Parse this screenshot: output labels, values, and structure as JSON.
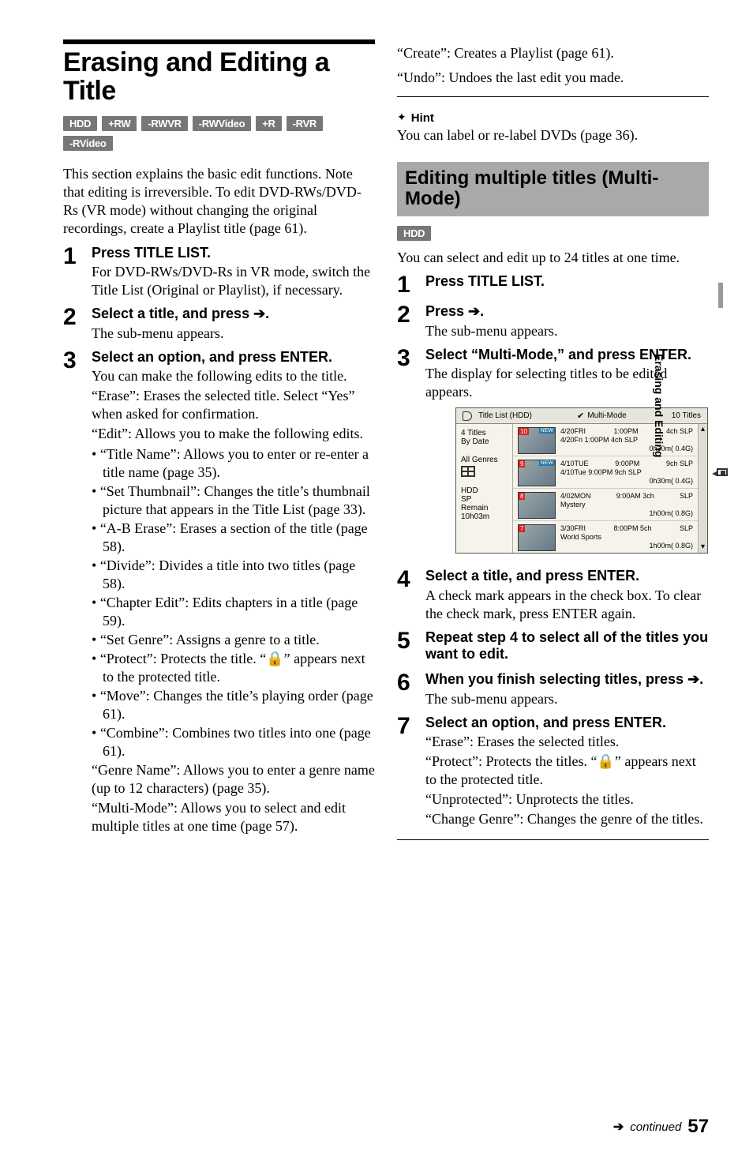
{
  "left": {
    "section_title": "Erasing and Editing a Title",
    "badges": [
      "HDD",
      "+RW",
      "-RWVR",
      "-RWVideo",
      "+R",
      "-RVR",
      "-RVideo"
    ],
    "intro": "This section explains the basic edit functions. Note that editing is irreversible. To edit DVD-RWs/DVD-Rs (VR mode) without changing the original recordings, create a Playlist title (page 61).",
    "steps": [
      {
        "num": "1",
        "head": "Press TITLE LIST.",
        "body": "For DVD-RWs/DVD-Rs in VR mode, switch the Title List (Original or Playlist), if necessary."
      },
      {
        "num": "2",
        "head": "Select a title, and press ➔.",
        "body": "The sub-menu appears."
      },
      {
        "num": "3",
        "head": "Select an option, and press ENTER.",
        "body_pre": "You can make the following edits to the title.",
        "lines_before_bullets": [
          "“Erase”: Erases the selected title. Select “Yes” when asked for confirmation.",
          "“Edit”: Allows you to make the following edits."
        ],
        "bullets": [
          "“Title Name”: Allows you to enter or re-enter a title name (page 35).",
          "“Set Thumbnail”: Changes the title’s thumbnail picture that appears in the Title List (page 33).",
          "“A-B Erase”: Erases a section of the title (page 58).",
          "“Divide”: Divides a title into two titles (page 58).",
          "“Chapter Edit”: Edits chapters in a title (page 59).",
          "“Set Genre”: Assigns a genre to a title.",
          "“Protect”: Protects the title. “🔒” appears next to the protected title.",
          "“Move”: Changes the title’s playing order (page 61).",
          "“Combine”: Combines two titles into one (page 61)."
        ],
        "lines_after_bullets": [
          "“Genre Name”: Allows you to enter a genre name (up to 12 characters) (page 35).",
          "“Multi-Mode”: Allows you to select and edit multiple titles at one time (page 57)."
        ]
      }
    ]
  },
  "right": {
    "top_lines": [
      "“Create”: Creates a Playlist (page 61).",
      "“Undo”: Undoes the last edit you made."
    ],
    "hint_label": "Hint",
    "hint_text": "You can label or re-label DVDs (page 36).",
    "subsection_title": "Editing multiple titles (Multi-Mode)",
    "sub_badge": "HDD",
    "sub_intro": "You can select and edit up to 24 titles at one time.",
    "steps": [
      {
        "num": "1",
        "head": "Press TITLE LIST."
      },
      {
        "num": "2",
        "head": "Press ➔.",
        "body": "The sub-menu appears."
      },
      {
        "num": "3",
        "head": "Select “Multi-Mode,” and press ENTER.",
        "body": "The display for selecting titles to be edited appears."
      },
      {
        "num": "4",
        "head": "Select a title, and press ENTER.",
        "body": "A check mark appears in the check box. To clear the check mark, press ENTER again."
      },
      {
        "num": "5",
        "head": "Repeat step 4 to select all of the titles you want to edit."
      },
      {
        "num": "6",
        "head": "When you finish selecting titles, press ➔.",
        "body": "The sub-menu appears."
      },
      {
        "num": "7",
        "head": "Select an option, and press ENTER.",
        "lines": [
          "“Erase”: Erases the selected titles.",
          "“Protect”: Protects the titles. “🔒” appears next to the protected title.",
          "“Unprotected”: Unprotects the titles.",
          "“Change Genre”: Changes the genre of the titles."
        ]
      }
    ],
    "titlelist": {
      "header_left": "Title List (HDD)",
      "header_mid": "Multi-Mode",
      "header_right": "10 Titles",
      "side": {
        "count": "4 Titles",
        "sort": "By Date",
        "genre": "All Genres",
        "disc": "HDD",
        "mode": "SP",
        "remain_label": "Remain",
        "remain": "10h03m"
      },
      "rows": [
        {
          "n": "10",
          "new": true,
          "l1a": "4/20FRI",
          "l1b": "1:00PM",
          "l1c": "4ch SLP",
          "l2": "4/20Fri   1:00PM 4ch SLP",
          "l3": "0h30m( 0.4G)"
        },
        {
          "n": "9",
          "new": true,
          "l1a": "4/10TUE",
          "l1b": "9:00PM",
          "l1c": "9ch SLP",
          "l2": "4/10Tue   9:00PM 9ch SLP",
          "l3": "0h30m( 0.4G)"
        },
        {
          "n": "8",
          "new": false,
          "l1a": "4/02MON",
          "l1b": "9:00AM 3ch",
          "l1c": "SLP",
          "l2": "Mystery",
          "l3": "1h00m( 0.8G)"
        },
        {
          "n": "7",
          "new": false,
          "l1a": "3/30FRI",
          "l1b": "8:00PM   5ch",
          "l1c": "SLP",
          "l2": "World Sports",
          "l3": "1h00m( 0.8G)"
        }
      ]
    }
  },
  "side_tab": "Erasing and Editing",
  "footer": {
    "arrow": "➔",
    "continued": "continued",
    "page": "57"
  }
}
